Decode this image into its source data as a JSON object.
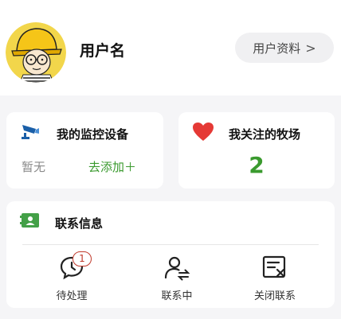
{
  "profile": {
    "username": "用户名",
    "profile_button_label": "用户资料",
    "profile_button_chevron": ">"
  },
  "devices_card": {
    "title": "我的监控设备",
    "empty_text": "暂无",
    "add_link_label": "去添加＋",
    "icon": "camera-icon",
    "icon_color": "#1a5fa8"
  },
  "farms_card": {
    "title": "我关注的牧场",
    "count": "2",
    "icon": "heart-icon",
    "icon_color": "#e53935",
    "count_color": "#3a9a2e"
  },
  "contact_card": {
    "title": "联系信息",
    "icon": "contact-card-icon",
    "icon_color": "#43a047",
    "actions": [
      {
        "label": "待处理",
        "icon": "pending-chat-icon",
        "badge": "1"
      },
      {
        "label": "联系中",
        "icon": "person-exchange-icon"
      },
      {
        "label": "关闭联系",
        "icon": "closed-message-icon"
      }
    ]
  },
  "colors": {
    "accent_green": "#3a9a2e",
    "badge_red": "#c0392b"
  }
}
